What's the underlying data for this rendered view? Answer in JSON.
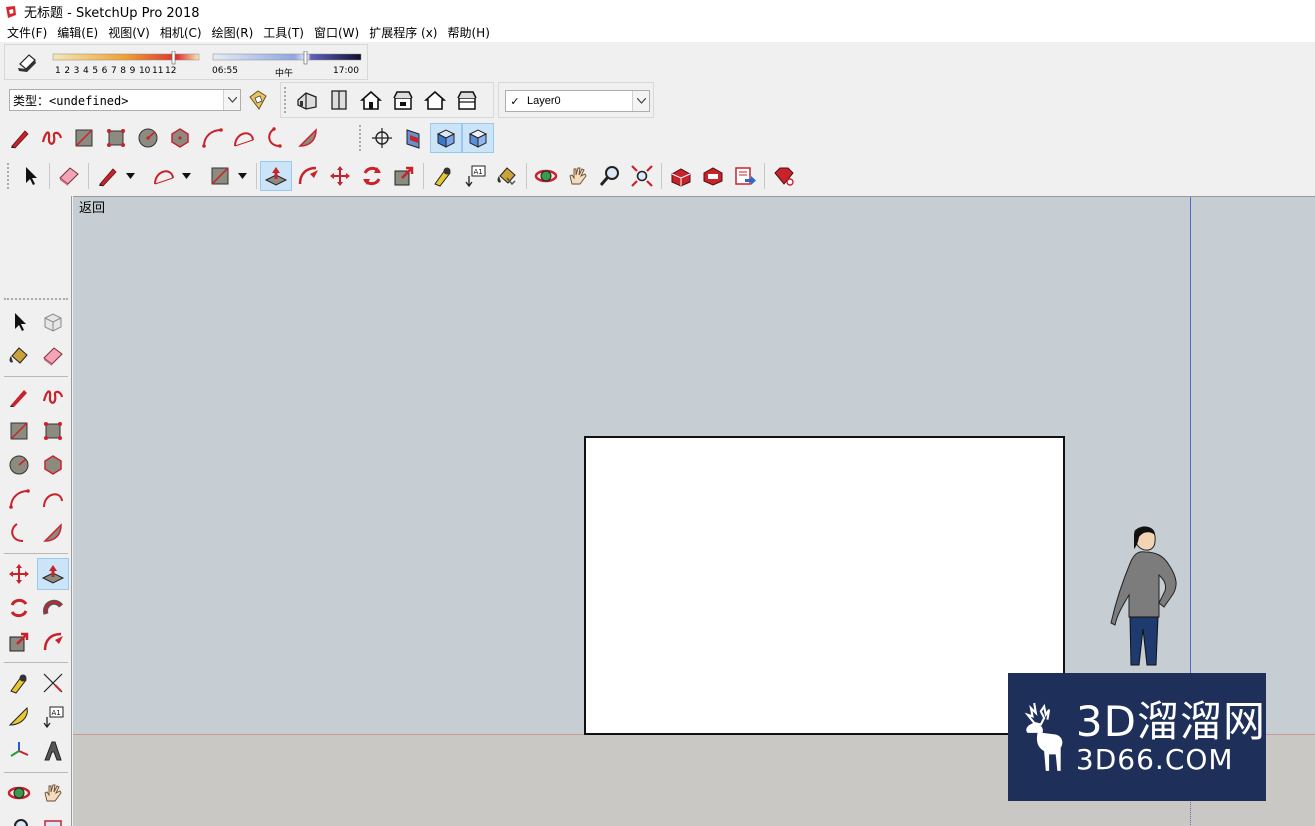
{
  "window": {
    "title": "无标题 - SketchUp Pro 2018"
  },
  "menu": [
    "文件(F)",
    "编辑(E)",
    "视图(V)",
    "相机(C)",
    "绘图(R)",
    "工具(T)",
    "窗口(W)",
    "扩展程序 (x)",
    "帮助(H)"
  ],
  "shadows": {
    "month_ticks": [
      "1",
      "2",
      "3",
      "4",
      "5",
      "6",
      "7",
      "8",
      "9",
      "10",
      "11",
      "12"
    ],
    "time_start": "06:55",
    "time_mid": "中午",
    "time_end": "17:00"
  },
  "type_combo": {
    "value": "类型：<undefined>"
  },
  "layer_combo": {
    "check": "✓",
    "value": "Layer0"
  },
  "viewport": {
    "back_label": "返回"
  },
  "watermark": {
    "line1": "3D溜溜网",
    "line2": "3D66.COM"
  },
  "colors": {
    "sky": "#c6cdd3",
    "ground": "#cac8c4",
    "accent_red": "#c8222b",
    "watermark_bg": "#1e2f59"
  }
}
